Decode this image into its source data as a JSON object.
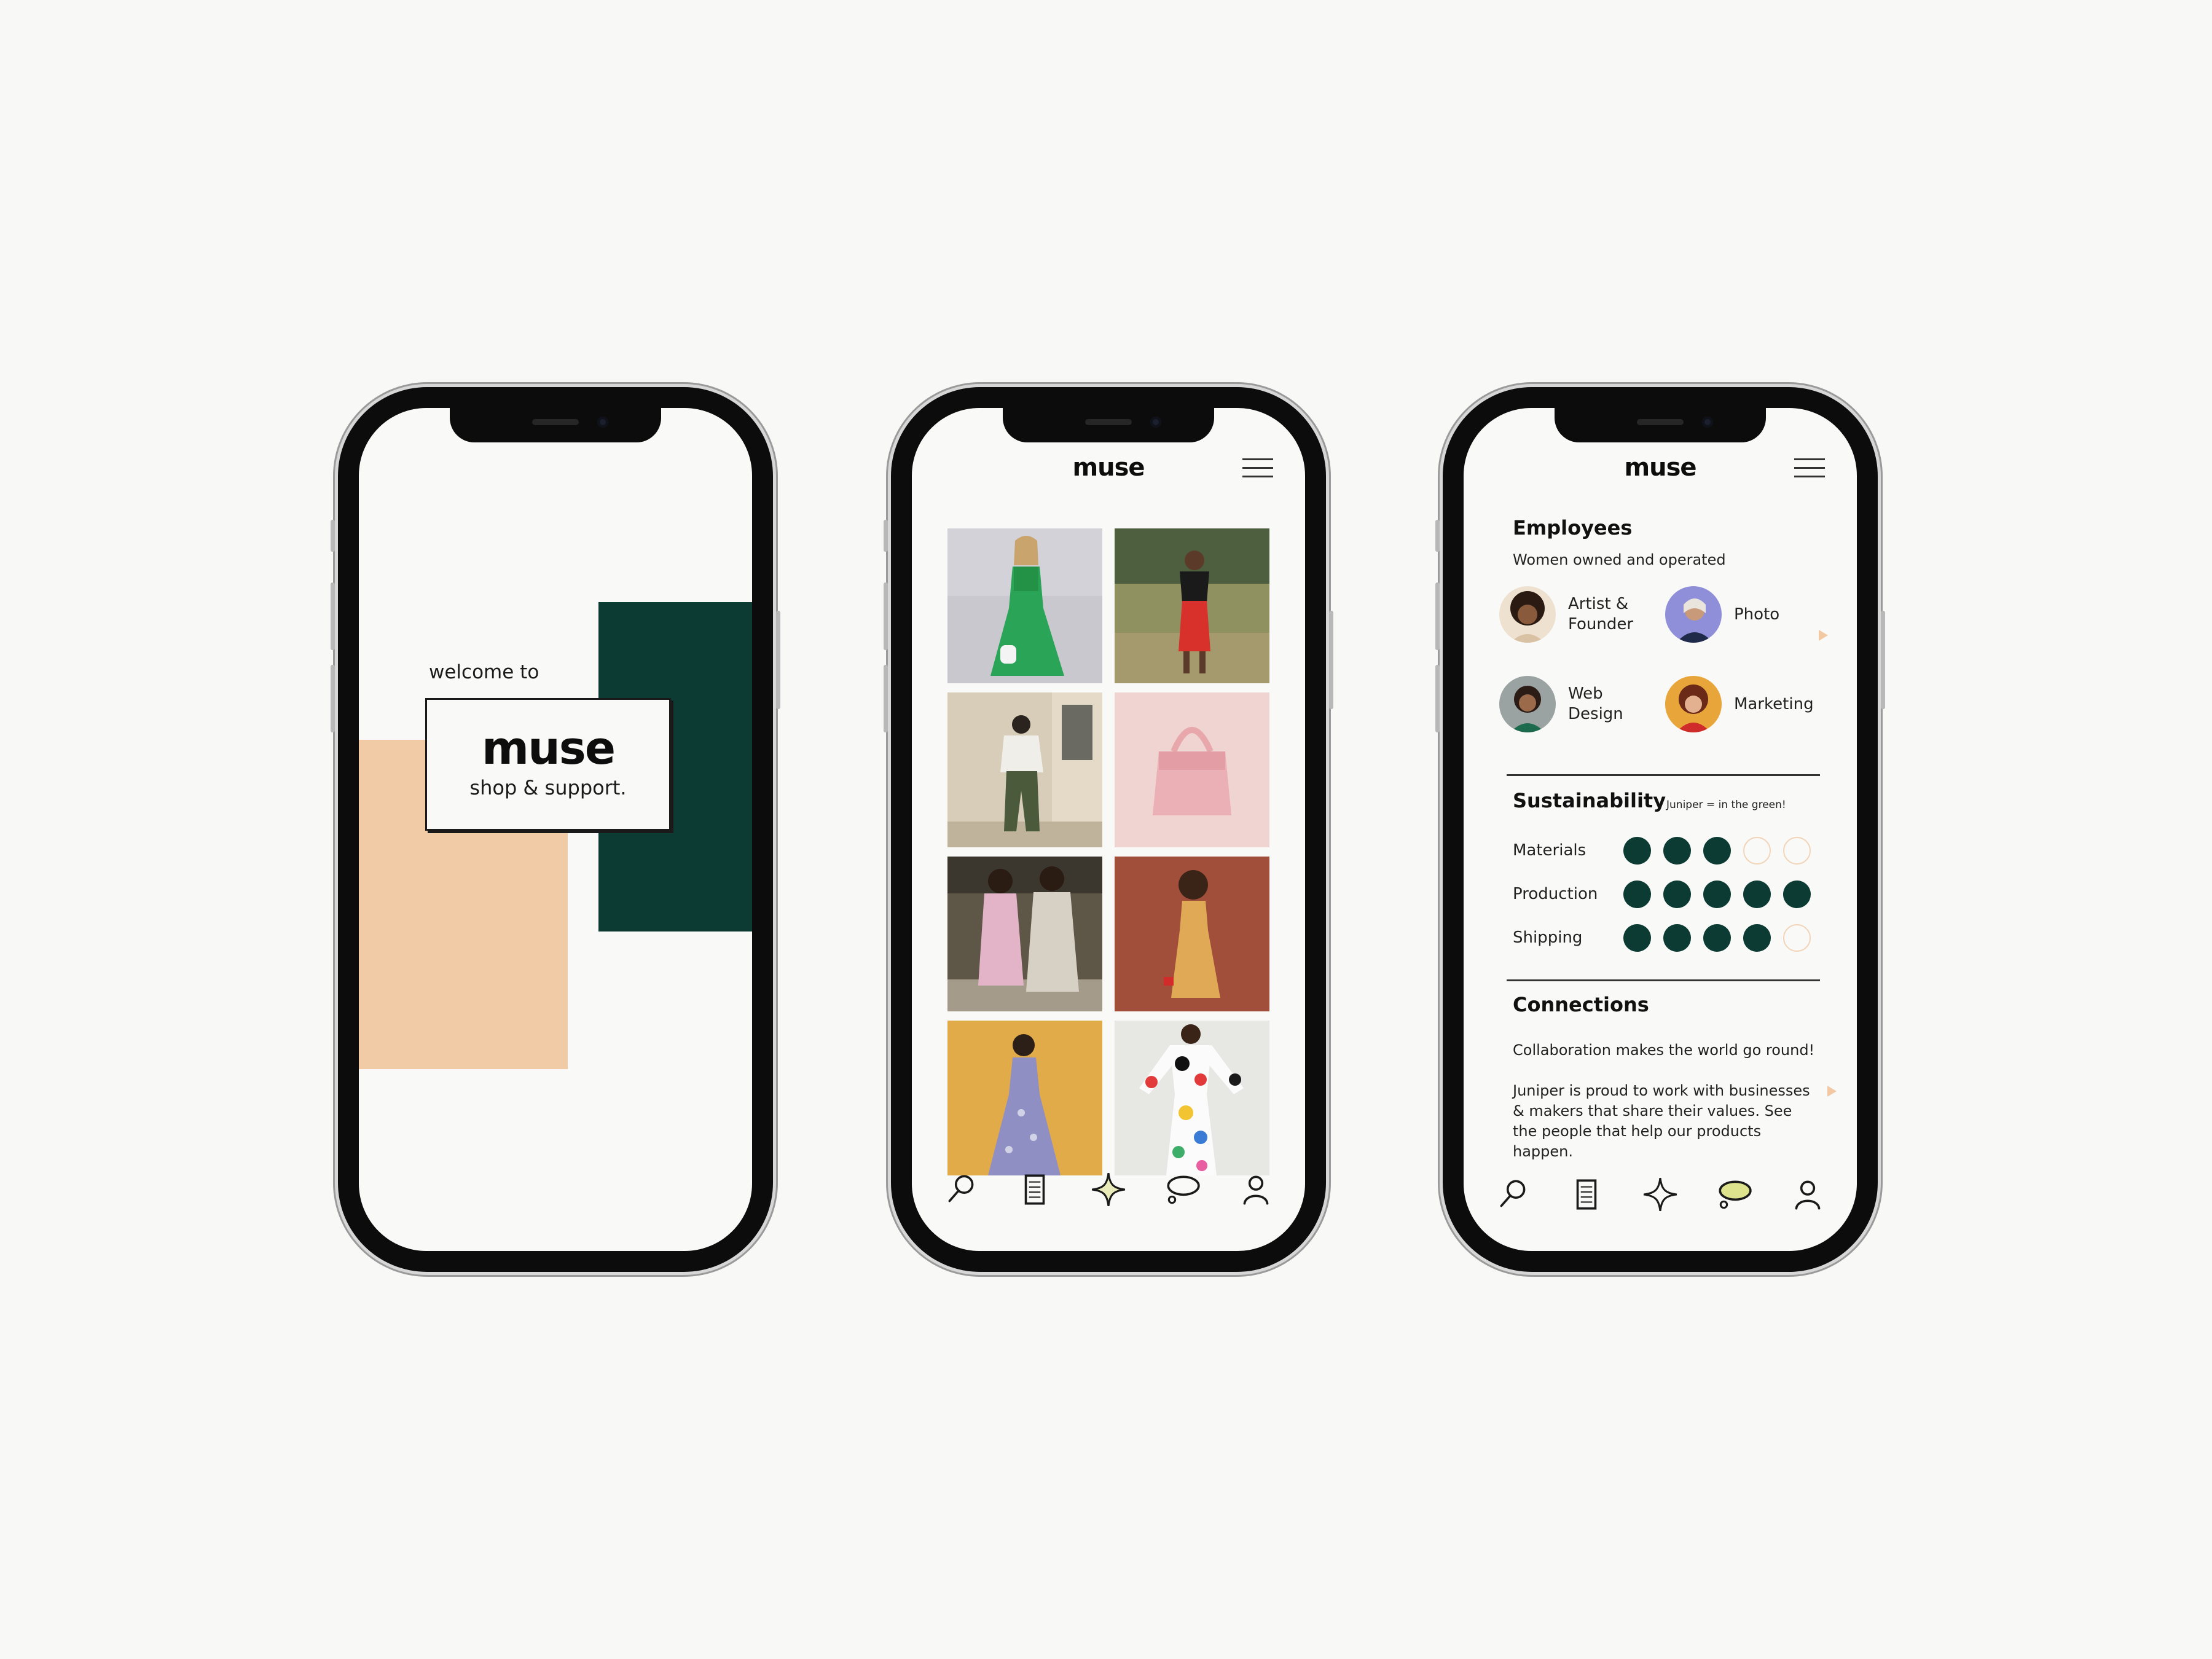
{
  "welcome": {
    "intro": "welcome to",
    "logo": "muse",
    "tagline": "shop & support."
  },
  "gallery": {
    "app_title": "muse",
    "tiles": [
      "woman in green dress",
      "woman in red skirt",
      "man in white sweater",
      "pink handbag",
      "two women in coats",
      "woman in yellow dress",
      "woman in blue floral dress",
      "colorful print dress"
    ]
  },
  "about": {
    "app_title": "muse",
    "employees": {
      "heading": "Employees",
      "subheading": "Women owned and operated",
      "people": [
        {
          "role": "Artist &\nFounder"
        },
        {
          "role": "Photo"
        },
        {
          "role": "Web\nDesign"
        },
        {
          "role": "Marketing"
        }
      ]
    },
    "sustainability": {
      "heading": "Sustainability",
      "note": "Juniper = in the green!",
      "metrics": [
        {
          "label": "Materials",
          "score": 3,
          "max": 5
        },
        {
          "label": "Production",
          "score": 5,
          "max": 5
        },
        {
          "label": "Shipping",
          "score": 4,
          "max": 5
        }
      ]
    },
    "connections": {
      "heading": "Connections",
      "line1": "Collaboration makes the world go round!",
      "line2": "Juniper is proud to work with businesses & makers that share their values. See the people that help our products happen."
    }
  },
  "nav": {
    "items": [
      "search-icon",
      "document-icon",
      "sparkle-icon",
      "speech-bubble-icon",
      "profile-icon"
    ],
    "active_on_about": "speech-bubble-icon"
  },
  "colors": {
    "green": "#0c3b33",
    "peach": "#f1cba6",
    "active_bubble": "#dde38c"
  }
}
